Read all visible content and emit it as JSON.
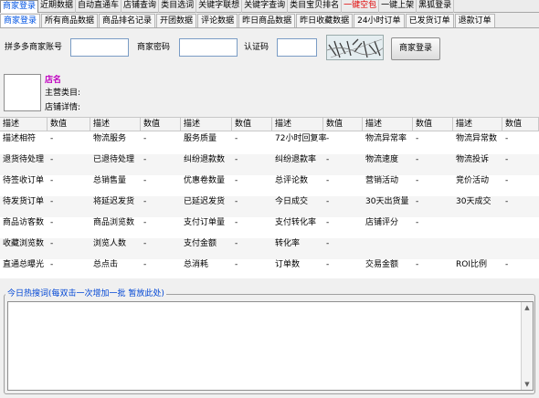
{
  "tabs_top": [
    {
      "label": "商家登录",
      "active": true
    },
    {
      "label": "近期数据"
    },
    {
      "label": "自动直通车"
    },
    {
      "label": "店铺查询"
    },
    {
      "label": "类目选词"
    },
    {
      "label": "关键字联想"
    },
    {
      "label": "关键字查询"
    },
    {
      "label": "类目宝贝排名"
    },
    {
      "label": "一键空包",
      "red": true
    },
    {
      "label": "一键上架"
    },
    {
      "label": "黑狐登录"
    }
  ],
  "tabs_sub": [
    {
      "label": "商家登录",
      "active": true
    },
    {
      "label": "所有商品数据"
    },
    {
      "label": "商品排名记录"
    },
    {
      "label": "开团数据"
    },
    {
      "label": "评论数据"
    },
    {
      "label": "昨日商品数据"
    },
    {
      "label": "昨日收藏数据"
    },
    {
      "label": "24小时订单"
    },
    {
      "label": "已发货订单"
    },
    {
      "label": "退款订单"
    }
  ],
  "login": {
    "account_label": "拼多多商家账号",
    "password_label": "商家密码",
    "captcha_label": "认证码",
    "button_label": "商家登录"
  },
  "shop": {
    "name_label": "店名",
    "category_label": "主营类目:",
    "detail_label": "店铺详情:"
  },
  "table": {
    "headers": [
      "描述",
      "数值",
      "描述",
      "数值",
      "描述",
      "数值",
      "描述",
      "数值",
      "描述",
      "数值",
      "描述",
      "数值"
    ],
    "rows": [
      [
        "描述相符",
        "-",
        "物流服务",
        "-",
        "服务质量",
        "-",
        "72小时回复率",
        "-",
        "物流异常率",
        "-",
        "物流异常数",
        "-"
      ],
      [
        "退货待处理",
        "-",
        "已退待处理",
        "-",
        "纠纷退款数",
        "-",
        "纠纷退款率",
        "-",
        "物流速度",
        "-",
        "物流投诉",
        "-"
      ],
      [
        "待签收订单",
        "-",
        "总销售量",
        "-",
        "优惠卷数量",
        "-",
        "总评论数",
        "-",
        "营销活动",
        "-",
        "竞价活动",
        "-"
      ],
      [
        "待发货订单",
        "-",
        "将延迟发货",
        "-",
        "已延迟发货",
        "-",
        "今日成交",
        "-",
        "30天出货量",
        "-",
        "30天成交",
        "-"
      ],
      [
        "商品访客数",
        "-",
        "商品浏览数",
        "-",
        "支付订单量",
        "-",
        "支付转化率",
        "-",
        "店铺评分",
        "-",
        "",
        ""
      ],
      [
        "收藏浏览数",
        "-",
        "浏览人数",
        "-",
        "支付金额",
        "-",
        "转化率",
        "-",
        "",
        "",
        "",
        ""
      ],
      [
        "直通总曝光",
        "-",
        "总点击",
        "-",
        "总消耗",
        "-",
        "订单数",
        "-",
        "交易金额",
        "-",
        "ROI比例",
        "-"
      ]
    ]
  },
  "hot": {
    "title": "今日热搜词(每双击一次增加一批  暂放此处)"
  }
}
